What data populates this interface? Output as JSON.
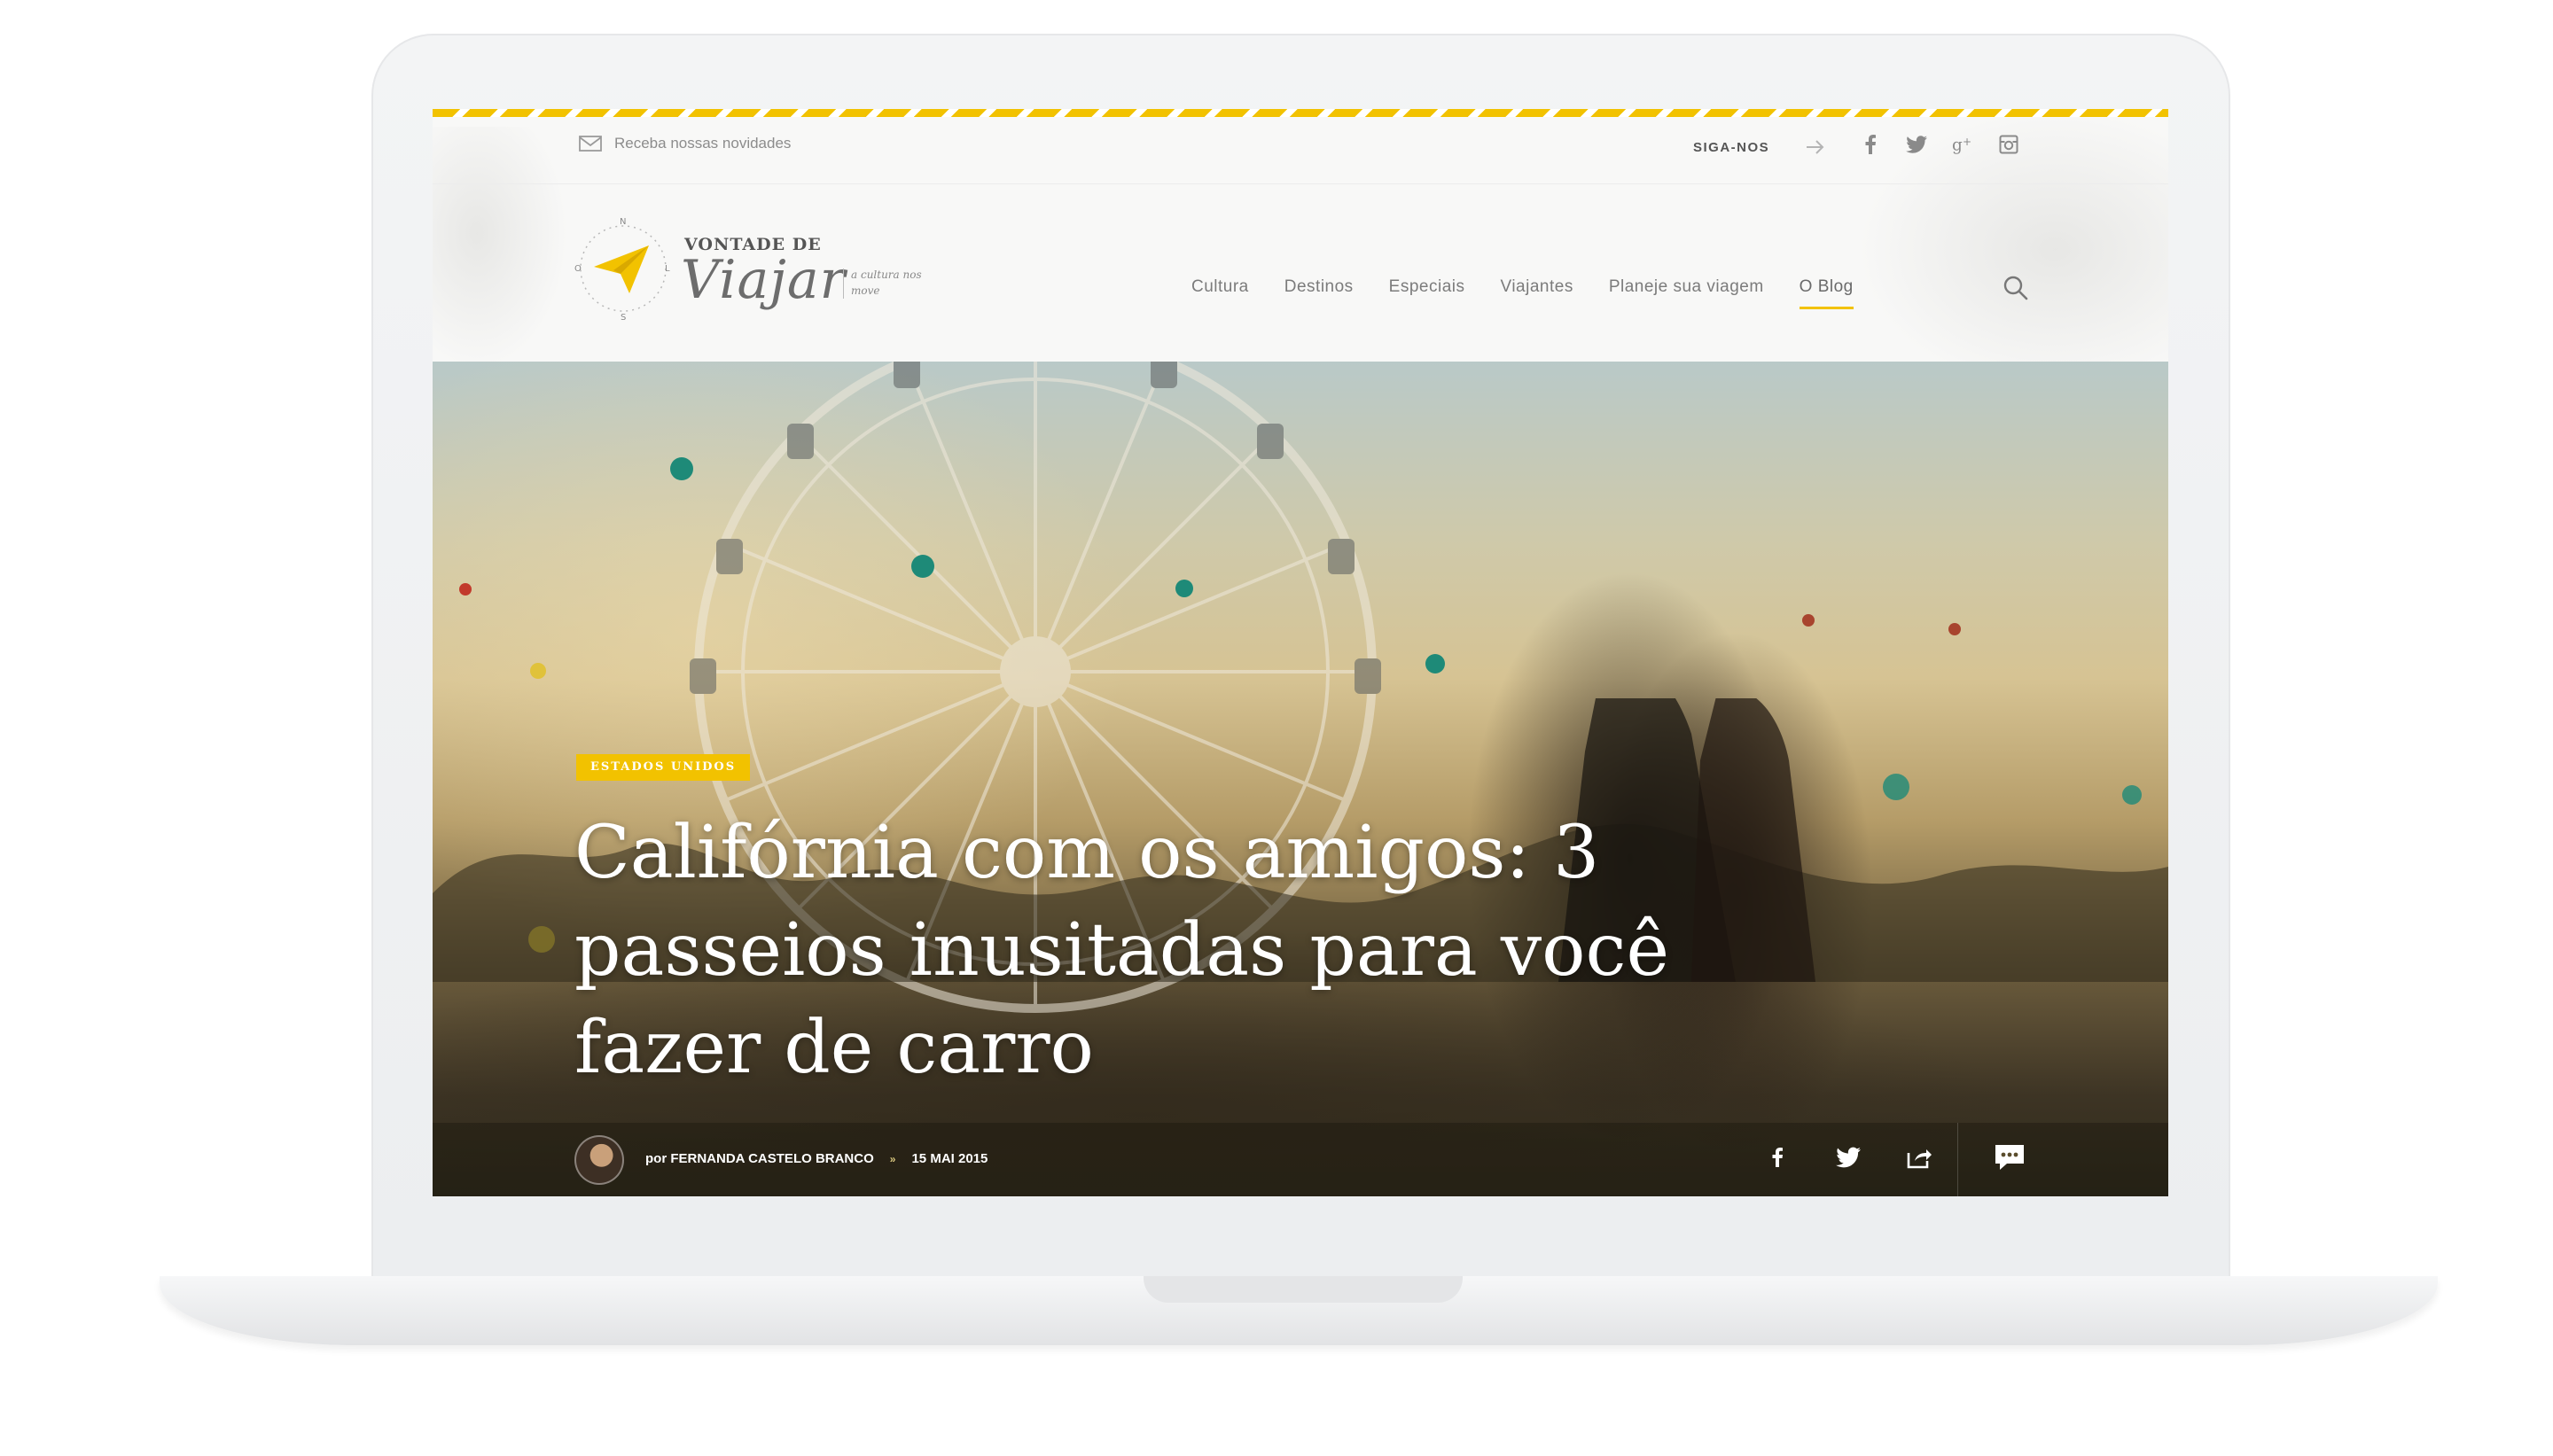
{
  "topbar": {
    "newsletter_label": "Receba nossas novidades",
    "follow_label": "SIGA-NOS",
    "social": [
      "facebook-icon",
      "twitter-icon",
      "google-plus-icon",
      "instagram-icon"
    ]
  },
  "logo": {
    "line1": "VONTADE DE",
    "line2": "Viajar",
    "tagline": "a cultura nos move",
    "compass": [
      "N",
      "S",
      "L",
      "O"
    ]
  },
  "nav": {
    "items": [
      "Cultura",
      "Destinos",
      "Especiais",
      "Viajantes",
      "Planeje sua viagem",
      "O Blog"
    ],
    "active": "O Blog"
  },
  "hero": {
    "category": "ESTADOS UNIDOS",
    "headline": "Califórnia com os amigos: 3 passeios inusitadas para você fazer de carro",
    "author": "por FERNANDA CASTELO BRANCO",
    "separator": "»",
    "date": "15 MAI 2015",
    "share": [
      "facebook-icon",
      "twitter-icon",
      "share-icon"
    ],
    "comments_icon": "comment-icon"
  },
  "colors": {
    "accent": "#f2c200",
    "nav_text": "#7b7b7b",
    "screen_bg": "#f8f8f7"
  }
}
